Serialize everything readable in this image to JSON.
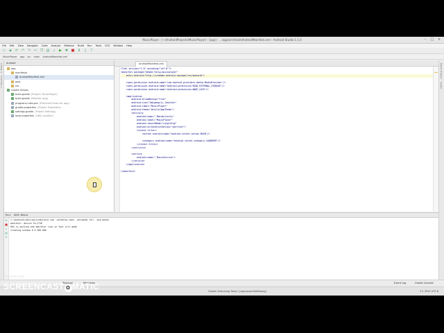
{
  "window": {
    "title": "MusicPlayer - [~/AndroidProjects/MusicPlayer] - [app] - ...\\app\\src\\main\\AndroidManifest.xml - Android Studio 1.1.0"
  },
  "menu": [
    "File",
    "Edit",
    "View",
    "Navigate",
    "Code",
    "Analyze",
    "Refactor",
    "Build",
    "Run",
    "Tools",
    "VCS",
    "Window",
    "Help"
  ],
  "breadcrumb": [
    "MusicPlayer",
    "app",
    "src",
    "main",
    "AndroidManifest.xml"
  ],
  "project_panel": {
    "header": "Android",
    "tree": [
      {
        "label": "app",
        "indent": 0,
        "icon": "folder",
        "sub": ""
      },
      {
        "label": "manifests",
        "indent": 1,
        "icon": "folder",
        "sub": ""
      },
      {
        "label": "AndroidManifest.xml",
        "indent": 2,
        "icon": "file",
        "sub": "",
        "selected": true
      },
      {
        "label": "java",
        "indent": 1,
        "icon": "folder",
        "sub": ""
      },
      {
        "label": "res",
        "indent": 1,
        "icon": "folder",
        "sub": ""
      },
      {
        "label": "Gradle Scripts",
        "indent": 0,
        "icon": "gradle",
        "sub": ""
      },
      {
        "label": "build.gradle",
        "indent": 1,
        "icon": "gradle",
        "sub": "(Project: MusicPlayer)"
      },
      {
        "label": "build.gradle",
        "indent": 1,
        "icon": "gradle",
        "sub": "(Module: app)"
      },
      {
        "label": "proguard-rules.pro",
        "indent": 1,
        "icon": "file",
        "sub": "(ProGuard Rules for app)"
      },
      {
        "label": "gradle.properties",
        "indent": 1,
        "icon": "file",
        "sub": "(Project Properties)"
      },
      {
        "label": "settings.gradle",
        "indent": 1,
        "icon": "gradle",
        "sub": "(Project Settings)"
      },
      {
        "label": "local.properties",
        "indent": 1,
        "icon": "file",
        "sub": "(SDK Location)"
      }
    ]
  },
  "editor": {
    "tab": "AndroidManifest.xml",
    "lines": [
      "<?xml version=\"1.0\" encoding=\"utf-8\"?>",
      "<manifest package=\"ahmed.farig.musicplayer\"",
      "    xmlns:android=\"http://schemas.android.com/apk/res/android\">",
      "",
      "    <uses-permission android:name=\"com.android.providers.media.MediaProvider\"/>",
      "    <uses-permission android:name=\"android.permission.READ_EXTERNAL_STORAGE\"/>",
      "    <uses-permission android:name=\"android.permission.WAKE_LOCK\"/>",
      "",
      "    <application",
      "        android:allowBackup=\"true\"",
      "        android:icon=\"@mipmap/ic_launcher\"",
      "        android:label=\"MusicPlayer\"",
      "        android:theme=\"@style/AppTheme\">",
      "        <activity",
      "            android:name=\".MainActivity\"",
      "            android:label=\"MusicPlayer\"",
      "            android:launchMode=\"singleTop\"",
      "            android:screenOrientation=\"portrait\">",
      "            <intent-filter>",
      "                <action android:name=\"android.intent.action.MAIN\"/>",
      "",
      "                <category android:name=\"android.intent.category.LAUNCHER\"/>",
      "            </intent-filter>",
      "        </activity>",
      "",
      "        <service",
      "            android:name=\".MusicService\">",
      "        </service>",
      "    </application>",
      "",
      "</manifest>"
    ],
    "highlight_line": 2
  },
  "run_panel": {
    "header_tabs": [
      "Run:",
      "AVD: Nexus"
    ],
    "console": [
      "C:\\Android\\sdk\\tools\\emulator.exe -netdelay none -netspeed full -avd phone",
      "emulator: device fd:1736",
      "HAX is working and emulator runs in fast virt mode",
      "creating window 0 0 480 800"
    ]
  },
  "bottom_tabs": [
    "Terminal",
    "Messages",
    "Event Log",
    "Gradle Console"
  ],
  "status": {
    "message": "Gradle: Executing Tasks: [:app:assembleDebug]",
    "position": "3:1  CRLF  UTF-8"
  },
  "watermark": {
    "recorded": "Recorded with",
    "logo_text": "SCREENCAST",
    "logo_tail": "MATIC"
  }
}
